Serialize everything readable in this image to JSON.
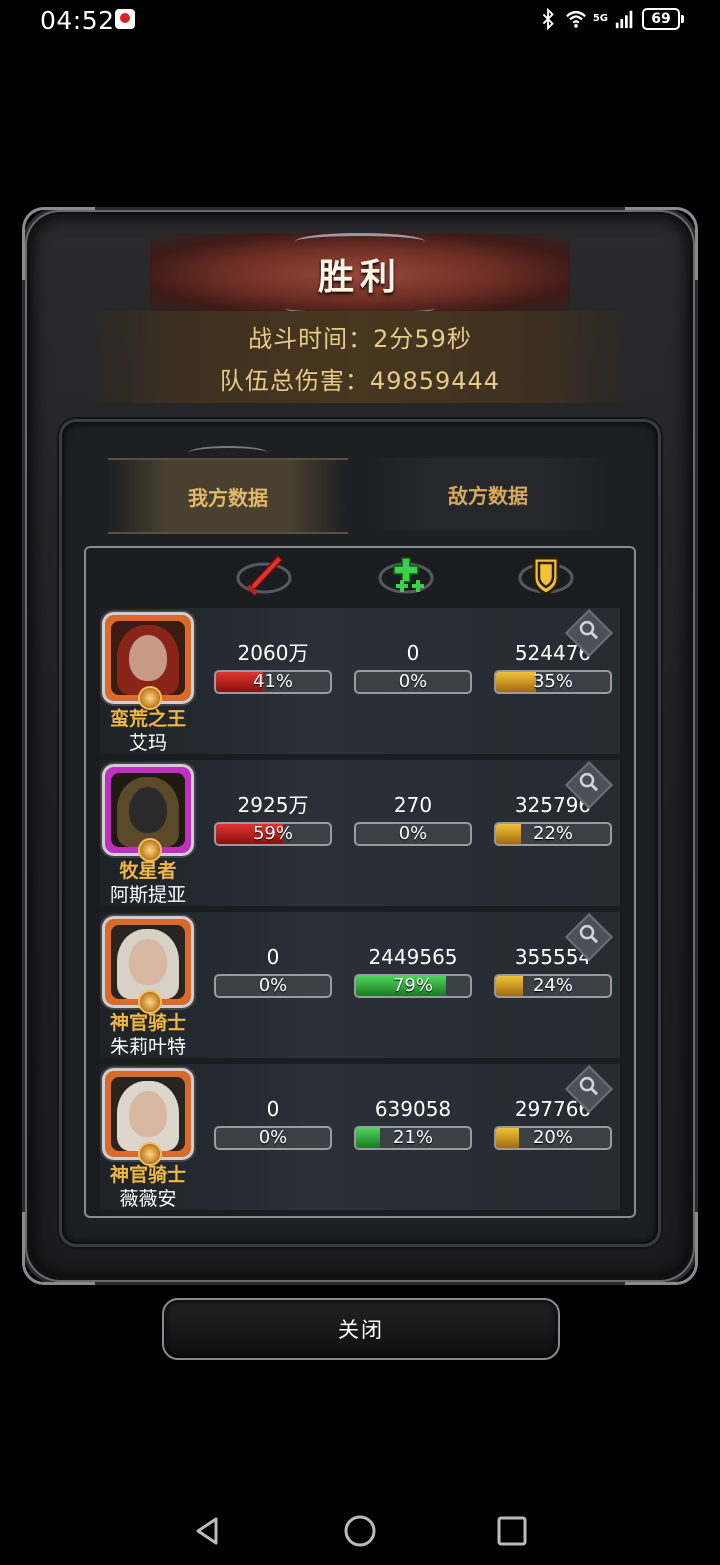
{
  "status_bar": {
    "time": "04:52",
    "network_label": "5G",
    "battery": "69",
    "icons": [
      "notification-icon",
      "bluetooth-icon",
      "wifi-icon",
      "signal-icon",
      "battery-icon"
    ]
  },
  "header": {
    "title": "胜利",
    "battle_time": "战斗时间：2分59秒",
    "total_damage": "队伍总伤害：49859444"
  },
  "tabs": [
    {
      "label": "我方数据",
      "active": true
    },
    {
      "label": "敌方数据",
      "active": false
    }
  ],
  "columns": [
    {
      "icon": "sword-icon",
      "color": "#e0352e"
    },
    {
      "icon": "heal-cross-icon",
      "color": "#4cd45a"
    },
    {
      "icon": "shield-icon",
      "color": "#f2c23a"
    }
  ],
  "heroes": [
    {
      "class": "蛮荒之王",
      "name": "艾玛",
      "frame_color": "#d96a2a",
      "damage": {
        "value": "2060万",
        "percent": "41%",
        "fraction": 0.41
      },
      "healing": {
        "value": "0",
        "percent": "0%",
        "fraction": 0
      },
      "tank": {
        "value": "524476",
        "percent": "35%",
        "fraction": 0.35
      }
    },
    {
      "class": "牧星者",
      "name": "阿斯提亚",
      "frame_color": "#c030c0",
      "damage": {
        "value": "2925万",
        "percent": "59%",
        "fraction": 0.59
      },
      "healing": {
        "value": "270",
        "percent": "0%",
        "fraction": 0
      },
      "tank": {
        "value": "325796",
        "percent": "22%",
        "fraction": 0.22
      }
    },
    {
      "class": "神官骑士",
      "name": "朱莉叶特",
      "frame_color": "#d96a2a",
      "damage": {
        "value": "0",
        "percent": "0%",
        "fraction": 0
      },
      "healing": {
        "value": "2449565",
        "percent": "79%",
        "fraction": 0.79
      },
      "tank": {
        "value": "355554",
        "percent": "24%",
        "fraction": 0.24
      }
    },
    {
      "class": "神官骑士",
      "name": "薇薇安",
      "frame_color": "#d96a2a",
      "damage": {
        "value": "0",
        "percent": "0%",
        "fraction": 0
      },
      "healing": {
        "value": "639058",
        "percent": "21%",
        "fraction": 0.21
      },
      "tank": {
        "value": "297766",
        "percent": "20%",
        "fraction": 0.2
      }
    }
  ],
  "close_label": "关闭"
}
